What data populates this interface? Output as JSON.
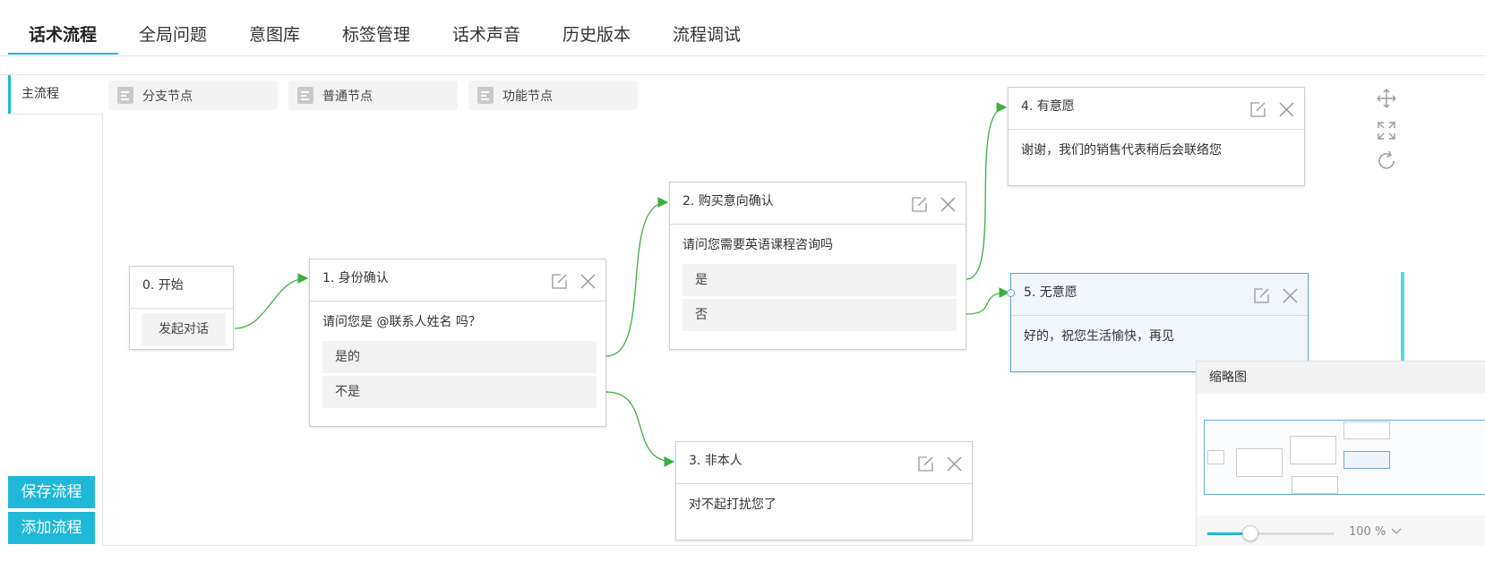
{
  "tabs": [
    {
      "label": "话术流程",
      "active": true
    },
    {
      "label": "全局问题"
    },
    {
      "label": "意图库"
    },
    {
      "label": "标签管理"
    },
    {
      "label": "话术声音"
    },
    {
      "label": "历史版本"
    },
    {
      "label": "流程调试"
    }
  ],
  "sidebar": {
    "items": [
      {
        "label": "主流程",
        "active": true
      }
    ],
    "save_button": "保存流程",
    "add_button": "添加流程"
  },
  "palette": [
    {
      "label": "分支节点",
      "icon": "list-icon"
    },
    {
      "label": "普通节点",
      "icon": "list-icon"
    },
    {
      "label": "功能节点",
      "icon": "list-icon"
    }
  ],
  "nodes": {
    "start": {
      "title": "0. 开始",
      "button": "发起对话"
    },
    "identity": {
      "title": "1. 身份确认",
      "text": "请问您是 @联系人姓名 吗？",
      "options": [
        "是的",
        "不是"
      ]
    },
    "purchase": {
      "title": "2. 购买意向确认",
      "text": "请问您需要英语课程咨询吗",
      "options": [
        "是",
        "否"
      ]
    },
    "not_self": {
      "title": "3. 非本人",
      "text": "对不起打扰您了"
    },
    "willing": {
      "title": "4. 有意愿",
      "text": "谢谢，我们的销售代表稍后会联络您"
    },
    "unwilling": {
      "title": "5. 无意愿",
      "text": "好的，祝您生活愉快，再见",
      "selected": true
    }
  },
  "tools": [
    "move-icon",
    "fit-screen-icon",
    "reset-icon"
  ],
  "minimap": {
    "title": "缩略图",
    "zoom_label": "100 %",
    "zoom_fraction": 0.34
  },
  "colors": {
    "accent": "#1fb8d8",
    "edge": "#3cb043",
    "selected_border": "#55a6e8"
  }
}
